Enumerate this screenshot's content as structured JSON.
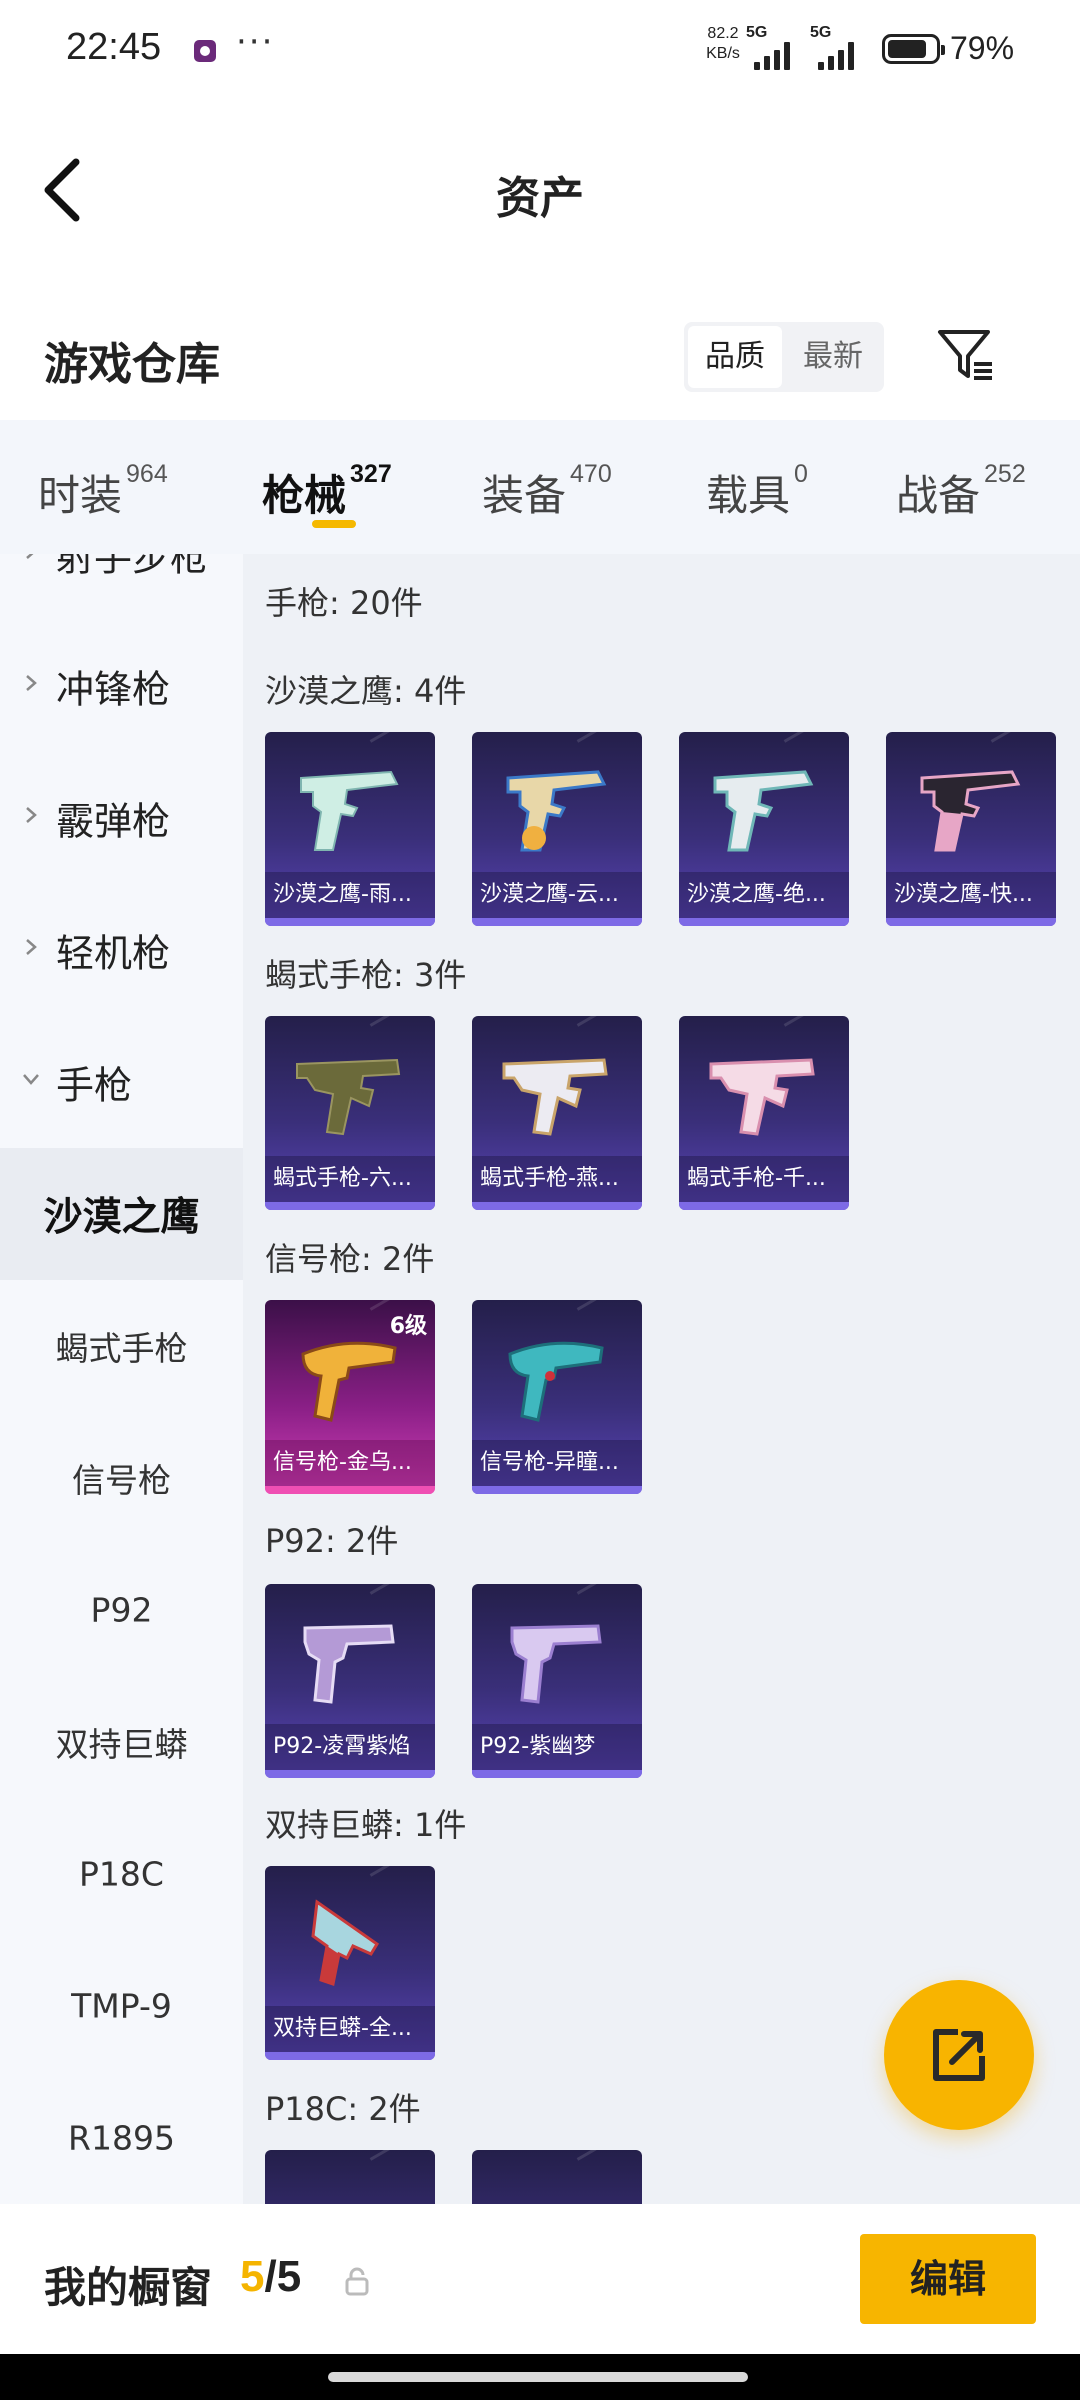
{
  "status_bar": {
    "time": "22:45",
    "dots": "···",
    "speed_value": "82.2",
    "speed_unit": "KB/s",
    "net1": "5G",
    "net2": "5G",
    "battery": "79%"
  },
  "header": {
    "title": "资产"
  },
  "warehouse": {
    "title": "游戏仓库",
    "sort_options": [
      "品质",
      "最新"
    ],
    "active_sort": "品质"
  },
  "tabs": [
    {
      "name": "时装",
      "count": "964"
    },
    {
      "name": "枪械",
      "count": "327",
      "active": true
    },
    {
      "name": "装备",
      "count": "470"
    },
    {
      "name": "载具",
      "count": "0"
    },
    {
      "name": "战备",
      "count": "252"
    }
  ],
  "sidebar": {
    "categories": [
      "射手步枪",
      "冲锋枪",
      "霰弹枪",
      "轻机枪",
      "手枪"
    ],
    "subcategories": [
      "沙漠之鹰",
      "蝎式手枪",
      "信号枪",
      "P92",
      "双持巨蟒",
      "P18C",
      "TMP-9",
      "R1895"
    ],
    "active_sub": "沙漠之鹰"
  },
  "main": {
    "summary": "手枪: 20件",
    "groups": [
      {
        "title": "沙漠之鹰: 4件",
        "items": [
          "沙漠之鹰-雨...",
          "沙漠之鹰-云...",
          "沙漠之鹰-绝...",
          "沙漠之鹰-快..."
        ]
      },
      {
        "title": "蝎式手枪: 3件",
        "items": [
          "蝎式手枪-六...",
          "蝎式手枪-燕...",
          "蝎式手枪-千..."
        ]
      },
      {
        "title": "信号枪: 2件",
        "items": [
          "信号枪-金乌...",
          "信号枪-异瞳..."
        ],
        "level": "6级"
      },
      {
        "title": "P92: 2件",
        "items": [
          "P92-凌霄紫焰",
          "P92-紫幽梦"
        ]
      },
      {
        "title": "双持巨蟒: 1件",
        "items": [
          "双持巨蟒-全..."
        ]
      },
      {
        "title": "P18C: 2件",
        "items": []
      }
    ]
  },
  "bottom_bar": {
    "label": "我的橱窗",
    "current": "5",
    "separator": "/",
    "total": "5",
    "edit_label": "编辑"
  },
  "colors": {
    "accent": "#f7b500",
    "card_purple": "#3a2f7a",
    "card_pink": "#d13fb7",
    "sidebar_bg": "#f6f8fc",
    "main_bg": "#eef1f6"
  }
}
